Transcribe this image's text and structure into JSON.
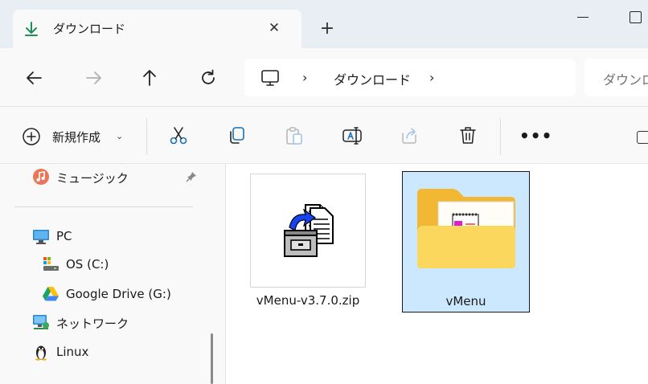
{
  "tab": {
    "title": "ダウンロード",
    "close": "✕",
    "new_tab": "+"
  },
  "nav": {
    "back": "back",
    "forward": "forward",
    "up": "up",
    "refresh": "refresh"
  },
  "address": {
    "separator": "›",
    "segments": [
      "ダウンロード"
    ],
    "search_placeholder": "ダウンロ"
  },
  "toolbar": {
    "new_label": "新規作成",
    "new_chevron": "⌄",
    "more": "•••"
  },
  "sidebar": {
    "music": "ミュージック",
    "items": [
      {
        "label": "PC",
        "icon": "monitor-icon"
      },
      {
        "label": "OS (C:)",
        "icon": "drive-icon"
      },
      {
        "label": "Google Drive (G:)",
        "icon": "google-drive-icon"
      },
      {
        "label": "ネットワーク",
        "icon": "network-icon"
      },
      {
        "label": "Linux",
        "icon": "penguin-icon"
      }
    ]
  },
  "files": [
    {
      "name": "vMenu-v3.7.0.zip",
      "icon": "zip-archive-icon",
      "selected": false
    },
    {
      "name": "vMenu",
      "icon": "folder-icon",
      "selected": true
    }
  ],
  "colors": {
    "accent": "#1e8f5a",
    "selection_bg": "#cce8ff",
    "selection_border": "#1a1a1a",
    "folder": "#f8c64c"
  }
}
